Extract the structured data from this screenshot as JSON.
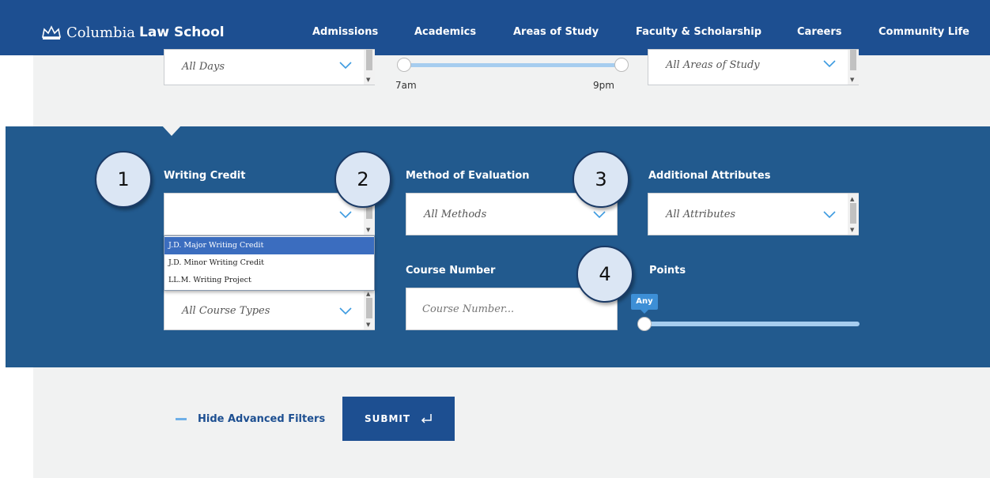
{
  "header": {
    "logo_name": "Columbia",
    "logo_bold": "Law School",
    "nav": [
      "Admissions",
      "Academics",
      "Areas of Study",
      "Faculty & Scholarship",
      "Careers",
      "Community Life"
    ]
  },
  "top_filters": {
    "days_value": "All Days",
    "time_min_label": "7am",
    "time_max_label": "9pm",
    "areas_value": "All Areas of Study"
  },
  "advanced": {
    "writing_credit": {
      "label": "Writing Credit",
      "value": "",
      "options": [
        "J.D. Major Writing Credit",
        "J.D. Minor Writing Credit",
        "LL.M. Writing Project"
      ],
      "highlighted": "J.D. Major Writing Credit"
    },
    "method": {
      "label": "Method of Evaluation",
      "value": "All Methods"
    },
    "attributes": {
      "label": "Additional Attributes",
      "value": "All Attributes"
    },
    "course_type": {
      "value": "All Course Types"
    },
    "course_number": {
      "label": "Course Number",
      "placeholder": "Course Number..."
    },
    "points": {
      "label": "Points",
      "value_label": "Any",
      "level": 0
    }
  },
  "markers": [
    "1",
    "2",
    "3",
    "4"
  ],
  "actions": {
    "hide_filters": "Hide Advanced Filters",
    "submit": "SUBMIT"
  },
  "colors": {
    "header_bg": "#1d4f91",
    "panel_bg": "#225a8e",
    "accent": "#6fb0e8",
    "highlight": "#3b6dbf"
  },
  "icons": [
    "crown-icon",
    "chevron-down-icon",
    "enter-return-icon"
  ]
}
